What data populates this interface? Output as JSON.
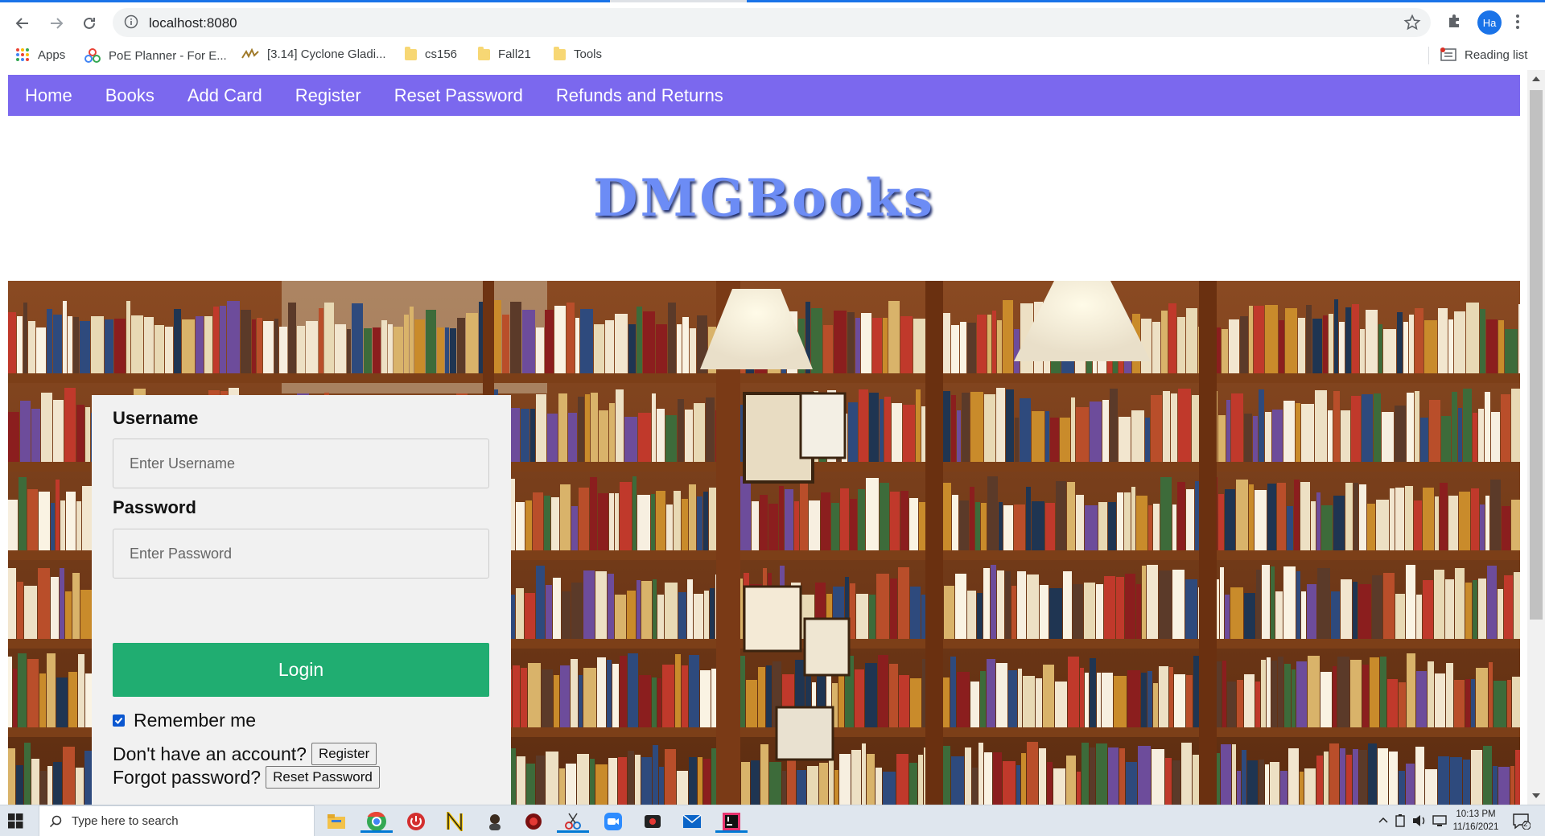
{
  "browser": {
    "url": "localhost:8080",
    "profile_initials": "Ha",
    "bookmarks": [
      {
        "label": "Apps",
        "icon": "apps-grid-icon"
      },
      {
        "label": "PoE Planner - For E...",
        "icon": "poe-planner-icon"
      },
      {
        "label": "[3.14] Cyclone Gladi...",
        "icon": "cyclone-icon"
      },
      {
        "label": "cs156",
        "icon": "folder-icon"
      },
      {
        "label": "Fall21",
        "icon": "folder-icon"
      },
      {
        "label": "Tools",
        "icon": "folder-icon"
      }
    ],
    "reading_list": "Reading list"
  },
  "site": {
    "nav": [
      "Home",
      "Books",
      "Add Card",
      "Register",
      "Reset Password",
      "Refunds and Returns"
    ],
    "brand": "DMGBooks",
    "colors": {
      "nav": "#7b68ee",
      "brand": "#6c8cf5",
      "login_button": "#20ad71"
    }
  },
  "login": {
    "username_label": "Username",
    "username_placeholder": "Enter Username",
    "password_label": "Password",
    "password_placeholder": "Enter Password",
    "login_button": "Login",
    "remember_label": "Remember me",
    "remember_checked": true,
    "no_account_text": "Don't have an account?",
    "register_button": "Register",
    "forgot_text": "Forgot password?",
    "reset_button": "Reset Password"
  },
  "taskbar": {
    "search_placeholder": "Type here to search",
    "time": "10:13 PM",
    "date": "11/16/2021",
    "notification_count": "2"
  }
}
